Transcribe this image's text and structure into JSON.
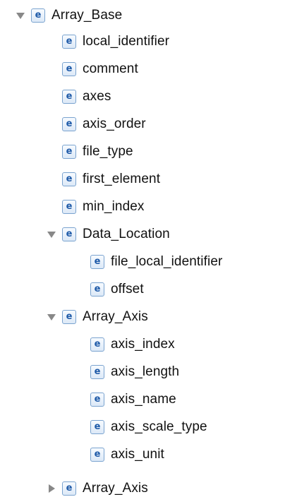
{
  "colors": {
    "icon_border": "#7aa3cf",
    "icon_letter": "#1e5aa8",
    "disclosure": "#888888",
    "text": "#111111"
  },
  "icon_letter": "e",
  "tree": {
    "root": {
      "label": "Array_Base",
      "expanded": true,
      "children": [
        {
          "label": "local_identifier"
        },
        {
          "label": "comment"
        },
        {
          "label": "axes"
        },
        {
          "label": "axis_order"
        },
        {
          "label": "file_type"
        },
        {
          "label": "first_element"
        },
        {
          "label": "min_index"
        },
        {
          "label": "Data_Location",
          "expanded": true,
          "children": [
            {
              "label": "file_local_identifier"
            },
            {
              "label": "offset"
            }
          ]
        },
        {
          "label": "Array_Axis",
          "expanded": true,
          "children": [
            {
              "label": "axis_index"
            },
            {
              "label": "axis_length"
            },
            {
              "label": "axis_name"
            },
            {
              "label": "axis_scale_type"
            },
            {
              "label": "axis_unit"
            }
          ]
        },
        {
          "label": "Array_Axis",
          "expanded": false
        }
      ]
    }
  }
}
